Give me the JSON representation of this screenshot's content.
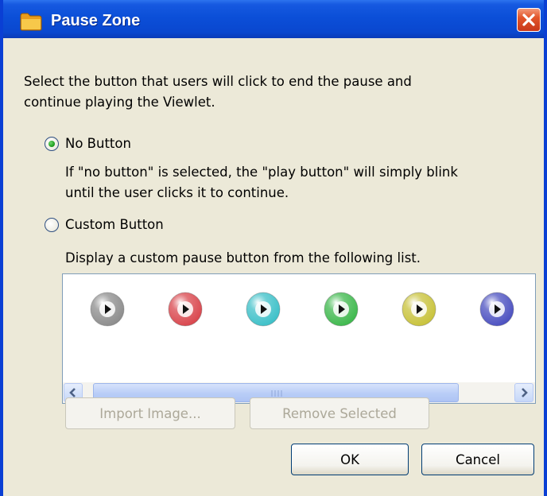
{
  "window": {
    "title": "Pause Zone",
    "close_icon": "close-icon",
    "app_icon": "folder-icon"
  },
  "dialog": {
    "instructions": [
      "Select the button that users will click to end the pause and",
      "continue playing the Viewlet."
    ],
    "options": [
      {
        "label": "No Button",
        "selected": true,
        "description": [
          "If \"no button\" is selected, the \"play button\" will simply blink",
          "until the user clicks it to continue."
        ]
      },
      {
        "label": "Custom Button",
        "selected": false,
        "description": [
          "Display a custom pause button from the following list."
        ]
      }
    ],
    "button_list": [
      {
        "name": "gray-play-button-icon",
        "color": "#8c8c8c"
      },
      {
        "name": "red-play-button-icon",
        "color": "#d9454c"
      },
      {
        "name": "cyan-play-button-icon",
        "color": "#3cc0c8"
      },
      {
        "name": "green-play-button-icon",
        "color": "#3db84c"
      },
      {
        "name": "yellow-play-button-icon",
        "color": "#c8c23a"
      },
      {
        "name": "blue-play-button-icon",
        "color": "#4a4fc0"
      }
    ],
    "actions": {
      "import_label": "Import Image...",
      "remove_label": "Remove Selected",
      "ok_label": "OK",
      "cancel_label": "Cancel"
    }
  },
  "colors": {
    "titlebar": "#0a47cf",
    "dialog_bg": "#ece9d8",
    "close_button": "#e2552a"
  }
}
